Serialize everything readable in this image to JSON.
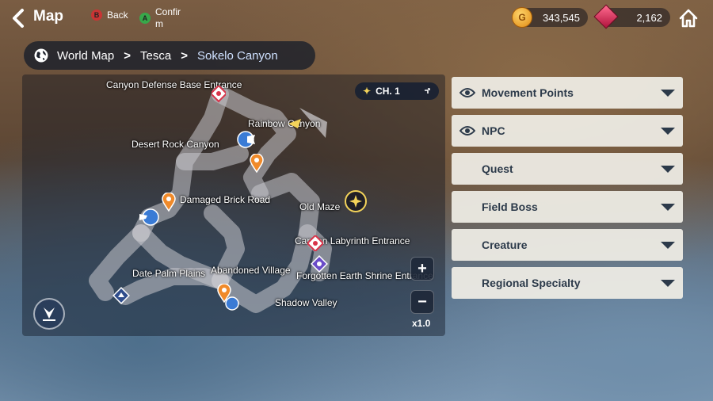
{
  "header": {
    "title": "Map",
    "back_hint_key": "B",
    "back_hint_label": "Back",
    "confirm_hint_key": "A",
    "confirm_hint_label": "Confirm"
  },
  "currency": {
    "gold_icon_letter": "G",
    "gold": "343,545",
    "gems": "2,162"
  },
  "breadcrumb": {
    "items": [
      "World Map",
      "Tesca",
      "Sokelo Canyon"
    ]
  },
  "map": {
    "chapter": "CH. 1",
    "zoom": "x1.0",
    "zoom_in": "+",
    "zoom_out": "−",
    "locations": [
      "Canyon Defense Base Entrance",
      "Rainbow Canyon",
      "Desert Rock Canyon",
      "Damaged Brick Road",
      "Old Maze",
      "Canyon Labyrinth Entrance",
      "Forgotten Earth Shrine Entrance",
      "Date Palm Plains",
      "Abandoned Village",
      "Shadow Valley"
    ]
  },
  "filters": [
    {
      "label": "Movement Points",
      "has_eye": true
    },
    {
      "label": "NPC",
      "has_eye": true
    },
    {
      "label": "Quest",
      "has_eye": false
    },
    {
      "label": "Field Boss",
      "has_eye": false
    },
    {
      "label": "Creature",
      "has_eye": false
    },
    {
      "label": "Regional Specialty",
      "has_eye": false
    }
  ],
  "colors": {
    "pin_orange": "#f08a2a",
    "npc_blue": "#3a7bd5",
    "red_marker": "#d8344a",
    "purple_marker": "#6a4bc8",
    "filter_bg": "#eeece4",
    "filter_text": "#2c3a4a"
  },
  "icons": [
    "chevron-left-icon",
    "globe-icon",
    "home-icon",
    "eye-icon",
    "caret-down-icon",
    "compass-icon",
    "location-pin-icon",
    "npc-icon",
    "shrine-icon",
    "boss-icon"
  ]
}
